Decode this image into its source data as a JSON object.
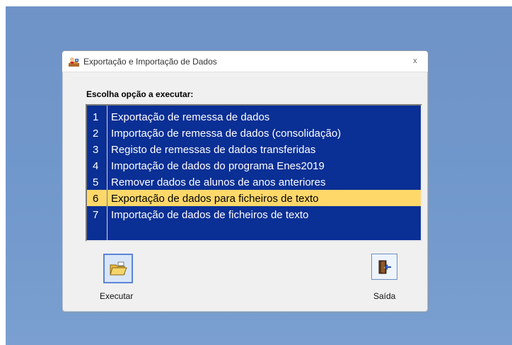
{
  "window": {
    "title": "Exportação e Importação de Dados",
    "close_glyph": "x"
  },
  "prompt": "Escolha opção a executar:",
  "options": [
    {
      "number": "1",
      "label": "Exportação de remessa de dados"
    },
    {
      "number": "2",
      "label": "Importação de remessa de dados (consolidação)"
    },
    {
      "number": "3",
      "label": "Registo de remessas de dados transferidas"
    },
    {
      "number": "4",
      "label": "Importação de dados do programa Enes2019"
    },
    {
      "number": "5",
      "label": "Remover dados de alunos de anos anteriores"
    },
    {
      "number": "6",
      "label": "Exportação de dados para ficheiros de texto"
    },
    {
      "number": "7",
      "label": "Importação de dados de ficheiros de texto"
    }
  ],
  "selected_option": "6",
  "buttons": {
    "execute": {
      "label": "Executar",
      "icon": "open-folder-icon"
    },
    "exit": {
      "label": "Saída",
      "icon": "exit-door-icon"
    }
  },
  "colors": {
    "desktop_background": "#7097cb",
    "list_background": "#0a2f95",
    "selected_row": "#ffd86a",
    "window_face": "#f0f0f0"
  }
}
